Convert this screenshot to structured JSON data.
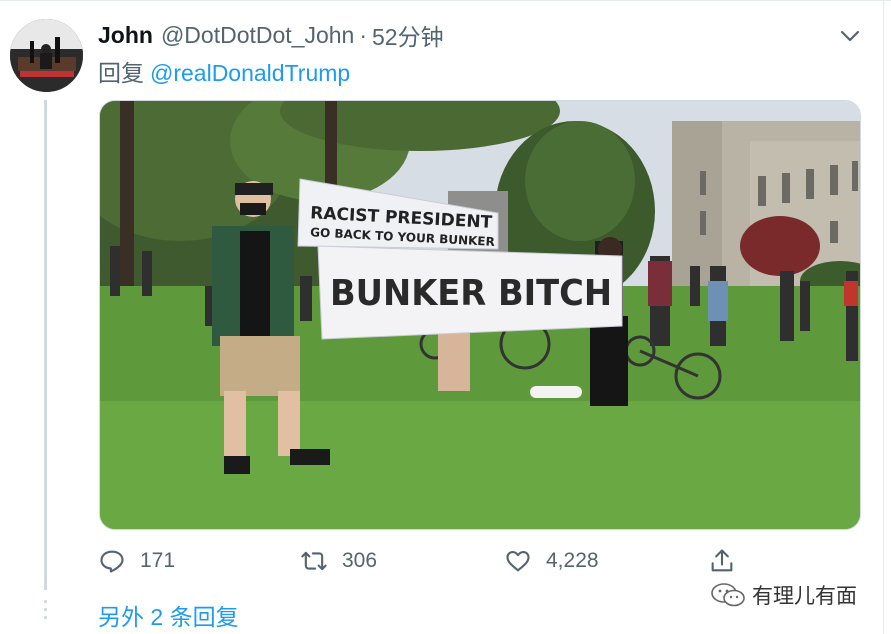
{
  "tweet": {
    "display_name": "John",
    "handle": "@DotDotDot_John",
    "separator": "·",
    "time": "52分钟",
    "reply_label": "回复",
    "reply_mention": "@realDonaldTrump",
    "media": {
      "sign_top_line1": "RACIST PRESIDENT",
      "sign_top_line2": "GO BACK TO YOUR BUNKER",
      "sign_main": "BUNKER BITCH"
    },
    "actions": {
      "reply_count": "171",
      "retweet_count": "306",
      "like_count": "4,228"
    },
    "more_replies": "另外 2 条回复"
  },
  "watermark": {
    "text": "有理儿有面"
  },
  "colors": {
    "link": "#1d9bf0",
    "muted": "#536471",
    "thread": "#cfd9de"
  },
  "icons": [
    "chevron-down-icon",
    "reply-icon",
    "retweet-icon",
    "like-icon",
    "share-icon",
    "wechat-icon"
  ]
}
